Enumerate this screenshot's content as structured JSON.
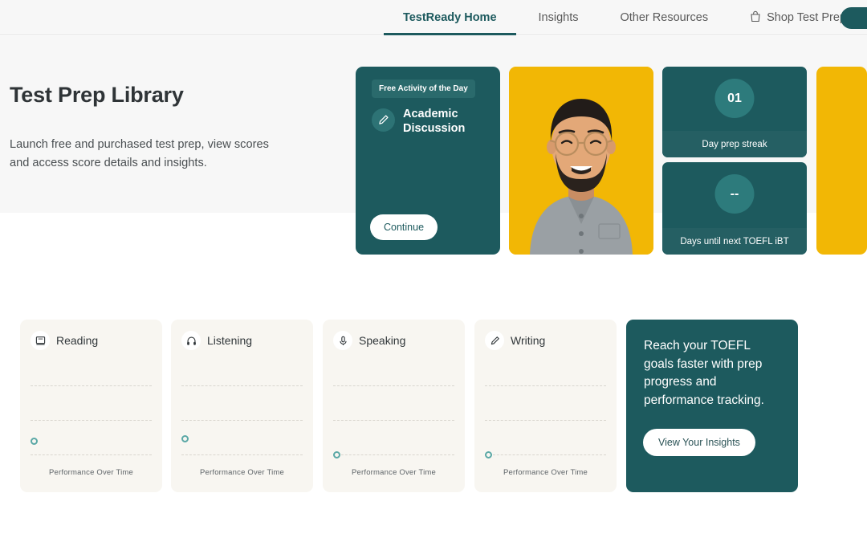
{
  "nav": {
    "items": [
      {
        "label": "TestReady Home",
        "active": true,
        "icon": null
      },
      {
        "label": "Insights",
        "active": false,
        "icon": null
      },
      {
        "label": "Other Resources",
        "active": false,
        "icon": null
      },
      {
        "label": "Shop Test Prep",
        "active": false,
        "icon": "shopping-bag-icon"
      }
    ],
    "account_pill": ""
  },
  "hero": {
    "title": "Test Prep Library",
    "subtitle": "Launch free and purchased test prep, view scores and access score details and insights."
  },
  "activity_card": {
    "badge": "Free Activity of the Day",
    "icon": "pencil-icon",
    "title": "Academic Discussion",
    "button": "Continue"
  },
  "portrait_card": {
    "alt": "smiling-person-portrait",
    "background_color": "#f2b705"
  },
  "stats": [
    {
      "value": "01",
      "label": "Day prep streak"
    },
    {
      "value": "--",
      "label": "Days until next TOEFL iBT"
    }
  ],
  "accent_bar": {
    "color": "#f2b705"
  },
  "skills": [
    {
      "name": "Reading",
      "icon": "book-icon",
      "caption": "Performance Over Time",
      "marker_level": 2
    },
    {
      "name": "Listening",
      "icon": "headphones-icon",
      "caption": "Performance Over Time",
      "marker_level": 2
    },
    {
      "name": "Speaking",
      "icon": "microphone-icon",
      "caption": "Performance Over Time",
      "marker_level": 3
    },
    {
      "name": "Writing",
      "icon": "pencil-icon",
      "caption": "Performance Over Time",
      "marker_level": 3
    }
  ],
  "promo": {
    "text": "Reach your TOEFL goals faster with prep progress and performance tracking.",
    "button": "View Your Insights"
  },
  "colors": {
    "teal": "#1d5a5e",
    "teal_light": "#2d7b7c",
    "yellow": "#f2b705",
    "card_bg": "#f8f6f1",
    "hero_bg": "#f7f7f7",
    "marker": "#5aa8a6"
  },
  "chart_data": {
    "type": "scatter",
    "title": "Performance Over Time",
    "panels": [
      {
        "name": "Reading",
        "x": [
          0
        ],
        "y": [
          1
        ],
        "ylim": [
          0,
          3
        ],
        "grid": true,
        "gridlines": [
          1,
          2,
          3
        ]
      },
      {
        "name": "Listening",
        "x": [
          0
        ],
        "y": [
          1
        ],
        "ylim": [
          0,
          3
        ],
        "grid": true,
        "gridlines": [
          1,
          2,
          3
        ]
      },
      {
        "name": "Speaking",
        "x": [
          0
        ],
        "y": [
          0
        ],
        "ylim": [
          0,
          3
        ],
        "grid": true,
        "gridlines": [
          1,
          2,
          3
        ]
      },
      {
        "name": "Writing",
        "x": [
          0
        ],
        "y": [
          0
        ],
        "ylim": [
          0,
          3
        ],
        "grid": true,
        "gridlines": [
          1,
          2,
          3
        ]
      }
    ],
    "xlabel": "Performance Over Time",
    "ylabel": "",
    "legend": []
  }
}
